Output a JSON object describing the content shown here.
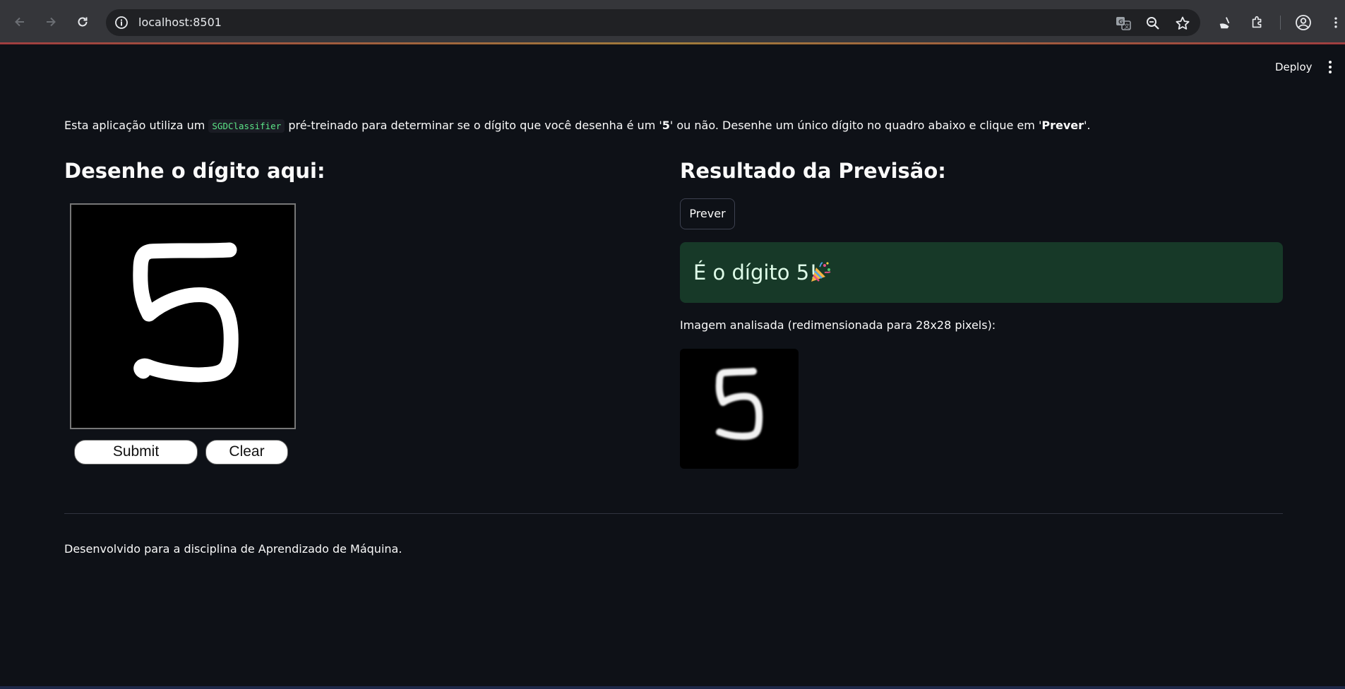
{
  "browser": {
    "url": "localhost:8501",
    "icons": [
      "back-arrow-icon",
      "forward-arrow-icon",
      "reload-icon",
      "site-info-icon",
      "translate-icon",
      "zoom-icon",
      "bookmark-star-icon",
      "clean-broom-icon",
      "extensions-puzzle-icon",
      "profile-icon",
      "chrome-menu-icon"
    ]
  },
  "header": {
    "deploy_label": "Deploy"
  },
  "intro": {
    "part1": "Esta aplicação utiliza um ",
    "code": "SGDClassifier",
    "part2": " pré-treinado para determinar se o dígito que você desenha é um '",
    "bold_digit": "5",
    "part3": "' ou não. Desenhe um único dígito no quadro abaixo e clique em '",
    "bold_button": "Prever",
    "part4": "'."
  },
  "left": {
    "heading": "Desenhe o dígito aqui:",
    "submit_label": "Submit",
    "clear_label": "Clear"
  },
  "right": {
    "heading": "Resultado da Previsão:",
    "predict_button": "Prever",
    "result_text": "É o dígito 5!",
    "result_icon": "party-popper-icon",
    "caption": "Imagem analisada (redimensionada para 28x28 pixels):"
  },
  "footer": {
    "text": "Desenvolvido para a disciplina de Aprendizado de Máquina."
  },
  "colors": {
    "background": "#0e1117",
    "success_bg": "#173928",
    "success_text": "#dffde9",
    "code_green": "#5ce488"
  }
}
